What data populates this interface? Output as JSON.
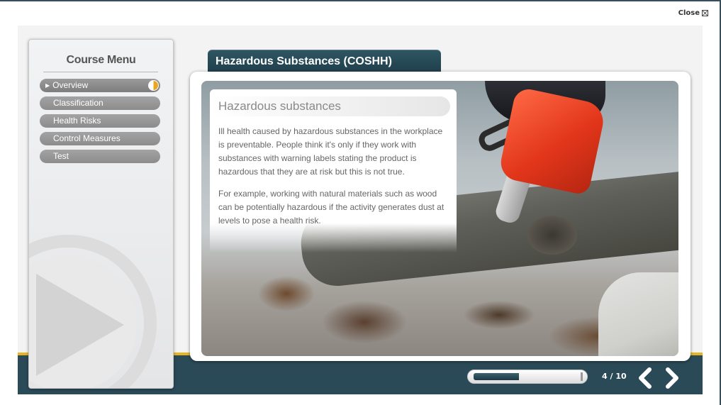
{
  "window": {
    "close_label": "Close"
  },
  "menu": {
    "title": "Course Menu",
    "items": [
      {
        "label": "Overview",
        "active": true
      },
      {
        "label": "Classification",
        "active": false
      },
      {
        "label": "Health Risks",
        "active": false
      },
      {
        "label": "Control Measures",
        "active": false
      },
      {
        "label": "Test",
        "active": false
      }
    ]
  },
  "page": {
    "title": "Hazardous Substances (COSHH)",
    "card_heading": "Hazardous substances",
    "paragraphs": [
      "Ill health caused by hazardous substances in the workplace is preventable. People think it's only if they work with substances with warning labels stating the product is hazardous that they are at risk but this is not true.",
      "For example, working with natural materials such as wood can be potentially hazardous if the activity generates dust at levels to pose a health risk."
    ]
  },
  "progress": {
    "current": 4,
    "total": 10,
    "counter_text": "4 / 10",
    "fraction": 0.4
  },
  "icons": {
    "close": "close-icon",
    "prev": "chevron-left-icon",
    "next": "chevron-right-icon",
    "play": "play-icon"
  },
  "colors": {
    "accent": "#e7b524",
    "nav_bar": "#2b4a57",
    "title_tab": "#2f5563",
    "menu_item": "#959595"
  }
}
